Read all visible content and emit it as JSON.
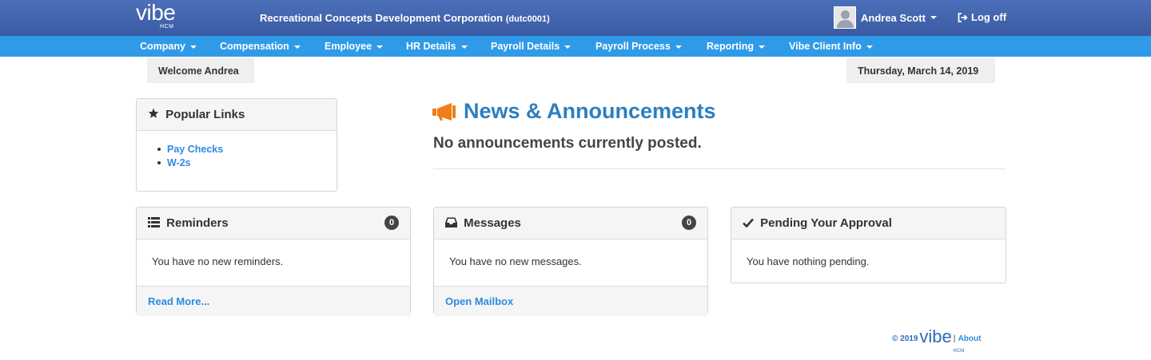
{
  "header": {
    "logo_text": "vibe",
    "logo_sub": "HCM",
    "company_name": "Recreational Concepts Development Corporation",
    "company_code": "(dutc0001)",
    "user_name": "Andrea Scott",
    "logoff_label": "Log off"
  },
  "nav": {
    "items": [
      {
        "label": "Company"
      },
      {
        "label": "Compensation"
      },
      {
        "label": "Employee"
      },
      {
        "label": "HR Details"
      },
      {
        "label": "Payroll Details"
      },
      {
        "label": "Payroll Process"
      },
      {
        "label": "Reporting"
      },
      {
        "label": "Vibe Client Info"
      }
    ]
  },
  "welcome": "Welcome Andrea",
  "date": "Thursday, March 14, 2019",
  "popular_links": {
    "title": "Popular Links",
    "links": [
      "Pay Checks",
      "W-2s"
    ]
  },
  "news": {
    "title": "News & Announcements",
    "text": "No announcements currently posted."
  },
  "reminders": {
    "title": "Reminders",
    "count": "0",
    "body": "You have no new reminders.",
    "footer_link": "Read More..."
  },
  "messages": {
    "title": "Messages",
    "count": "0",
    "body": "You have no new messages.",
    "footer_link": "Open Mailbox"
  },
  "pending": {
    "title": "Pending Your Approval",
    "body": "You have nothing pending."
  },
  "footer": {
    "copyright": "© 2019",
    "logo_text": "vibe",
    "logo_sub": "HCM",
    "separator": "|",
    "about": "About"
  },
  "colors": {
    "topbar": "#3f62ad",
    "nav": "#2f9ae8",
    "link": "#2f8be0",
    "news_title": "#2c7fc0",
    "megaphone": "#f07d1a"
  }
}
